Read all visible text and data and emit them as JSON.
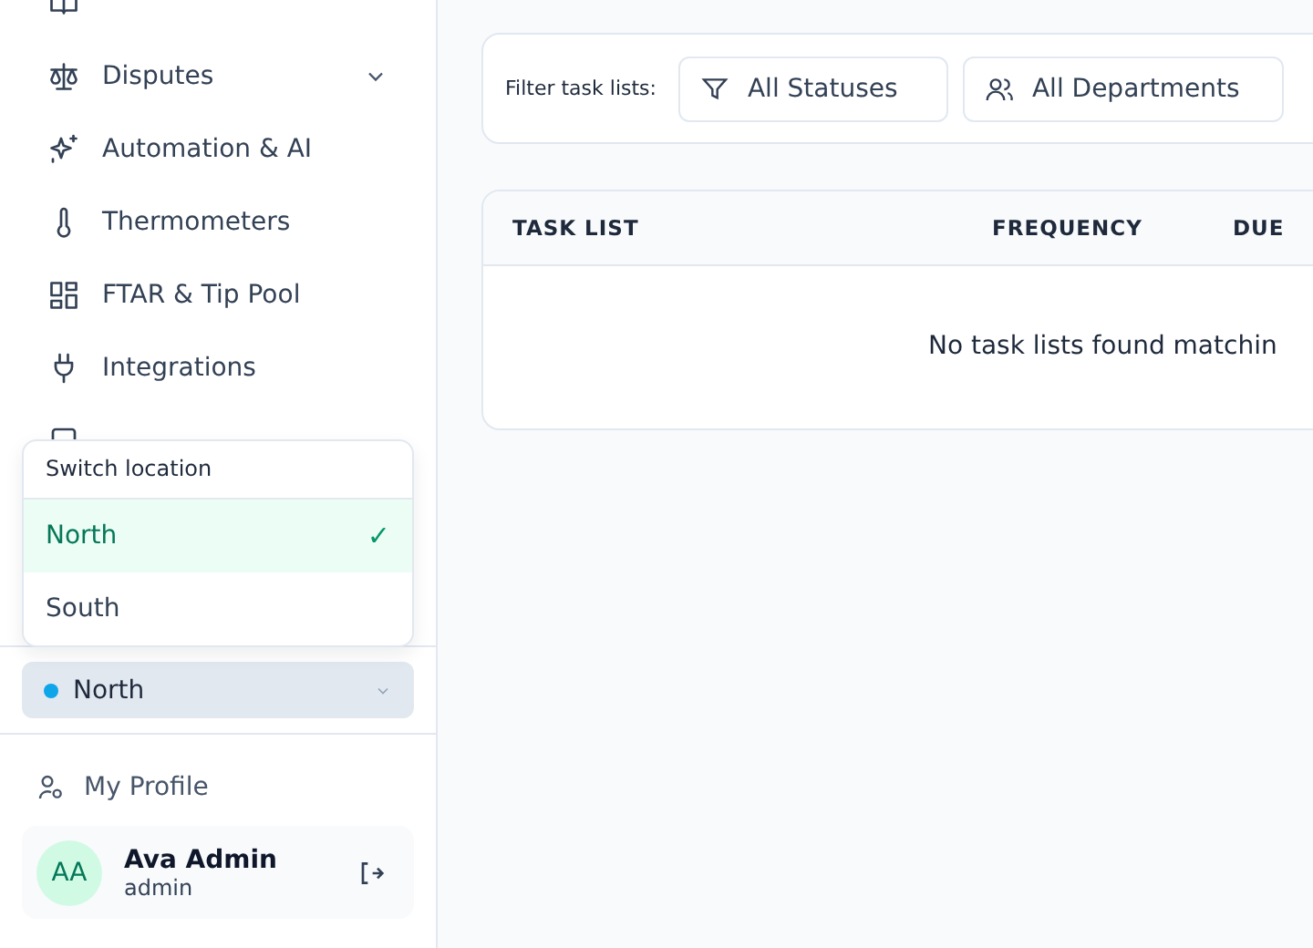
{
  "sidebar": {
    "items": [
      {
        "label": "Disputes",
        "expandable": true
      },
      {
        "label": "Automation & AI",
        "expandable": false
      },
      {
        "label": "Thermometers",
        "expandable": false
      },
      {
        "label": "FTAR & Tip Pool",
        "expandable": false
      },
      {
        "label": "Integrations",
        "expandable": false
      }
    ],
    "location_menu": {
      "title": "Switch location",
      "options": [
        {
          "label": "North",
          "selected": true,
          "mark": "✓"
        },
        {
          "label": "South",
          "selected": false
        }
      ]
    },
    "location_select": {
      "value": "North",
      "color": "#0ea5e9"
    },
    "profile_link": "My Profile",
    "user": {
      "initials": "AA",
      "name": "Ava Admin",
      "role": "admin"
    }
  },
  "filters": {
    "label": "Filter task lists:",
    "status": "All Statuses",
    "department": "All Departments"
  },
  "table": {
    "columns": [
      "TASK LIST",
      "FREQUENCY",
      "DUE"
    ],
    "empty_message": "No task lists found matchin"
  }
}
